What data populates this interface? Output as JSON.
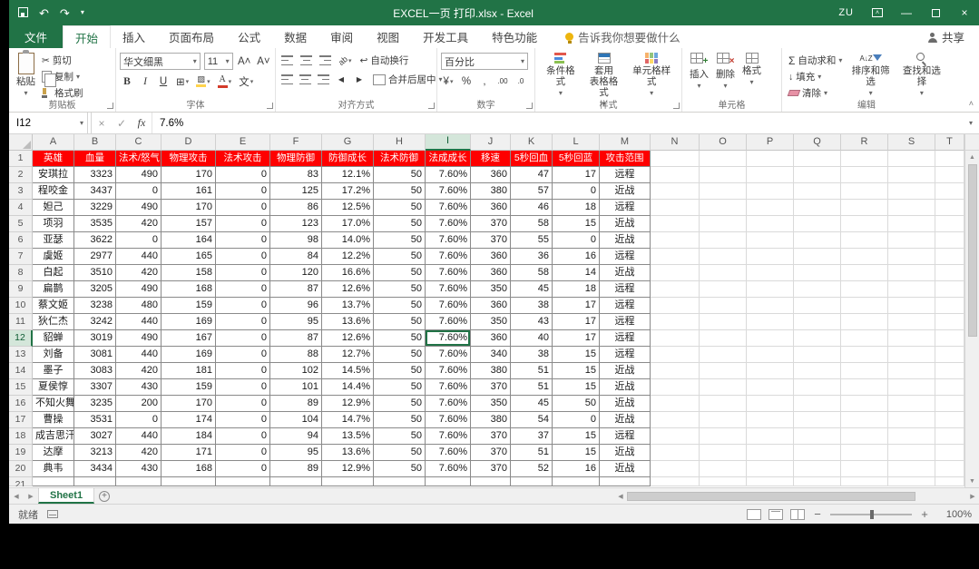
{
  "window": {
    "title": "EXCEL一页 打印.xlsx - Excel",
    "user": "ZU"
  },
  "tabs": {
    "file": "文件",
    "items": [
      "开始",
      "插入",
      "页面布局",
      "公式",
      "数据",
      "审阅",
      "视图",
      "开发工具",
      "特色功能"
    ],
    "selected_index": 0,
    "tell_me": "告诉我你想要做什么",
    "share": "共享"
  },
  "ribbon": {
    "font_name": "华文细黑",
    "font_size": "11",
    "number_format": "百分比",
    "clipboard": {
      "group": "剪贴板",
      "paste": "粘贴",
      "cut": "剪切",
      "copy": "复制",
      "painter": "格式刷"
    },
    "font_group": "字体",
    "alignment": {
      "group": "对齐方式",
      "wrap": "自动换行",
      "merge": "合并后居中"
    },
    "number_group": "数字",
    "styles": {
      "group": "样式",
      "conditional": "条件格式",
      "table_line1": "套用",
      "table_line2": "表格格式",
      "cell": "单元格样式"
    },
    "cells": {
      "group": "单元格",
      "insert": "插入",
      "delete": "删除",
      "format": "格式"
    },
    "editing": {
      "group": "编辑",
      "autosum": "自动求和",
      "fill": "填充",
      "clear": "清除",
      "sort": "排序和筛选",
      "find": "查找和选择"
    }
  },
  "formula_bar": {
    "name_box": "I12",
    "fx": "fx",
    "value": "7.6%"
  },
  "selection": {
    "cell_ref": "I12"
  },
  "grid": {
    "columns": [
      "A",
      "B",
      "C",
      "D",
      "E",
      "F",
      "G",
      "H",
      "I",
      "J",
      "K",
      "L",
      "M",
      "N",
      "O",
      "P",
      "Q",
      "R",
      "S",
      "T"
    ],
    "row_count": 21
  },
  "table": {
    "headers": [
      "英雄",
      "血量",
      "法术/怒气",
      "物理攻击",
      "法术攻击",
      "物理防御",
      "防御成长",
      "法术防御",
      "法成成长",
      "移速",
      "5秒回血",
      "5秒回蓝",
      "攻击范围"
    ],
    "rows": [
      [
        "安琪拉",
        "3323",
        "490",
        "170",
        "0",
        "83",
        "12.1%",
        "50",
        "7.60%",
        "360",
        "47",
        "17",
        "远程"
      ],
      [
        "程咬金",
        "3437",
        "0",
        "161",
        "0",
        "125",
        "17.2%",
        "50",
        "7.60%",
        "380",
        "57",
        "0",
        "近战"
      ],
      [
        "妲己",
        "3229",
        "490",
        "170",
        "0",
        "86",
        "12.5%",
        "50",
        "7.60%",
        "360",
        "46",
        "18",
        "远程"
      ],
      [
        "项羽",
        "3535",
        "420",
        "157",
        "0",
        "123",
        "17.0%",
        "50",
        "7.60%",
        "370",
        "58",
        "15",
        "近战"
      ],
      [
        "亚瑟",
        "3622",
        "0",
        "164",
        "0",
        "98",
        "14.0%",
        "50",
        "7.60%",
        "370",
        "55",
        "0",
        "近战"
      ],
      [
        "虞姬",
        "2977",
        "440",
        "165",
        "0",
        "84",
        "12.2%",
        "50",
        "7.60%",
        "360",
        "36",
        "16",
        "远程"
      ],
      [
        "白起",
        "3510",
        "420",
        "158",
        "0",
        "120",
        "16.6%",
        "50",
        "7.60%",
        "360",
        "58",
        "14",
        "近战"
      ],
      [
        "扁鹊",
        "3205",
        "490",
        "168",
        "0",
        "87",
        "12.6%",
        "50",
        "7.60%",
        "350",
        "45",
        "18",
        "远程"
      ],
      [
        "蔡文姬",
        "3238",
        "480",
        "159",
        "0",
        "96",
        "13.7%",
        "50",
        "7.60%",
        "360",
        "38",
        "17",
        "远程"
      ],
      [
        "狄仁杰",
        "3242",
        "440",
        "169",
        "0",
        "95",
        "13.6%",
        "50",
        "7.60%",
        "350",
        "43",
        "17",
        "远程"
      ],
      [
        "貂蝉",
        "3019",
        "490",
        "167",
        "0",
        "87",
        "12.6%",
        "50",
        "7.60%",
        "360",
        "40",
        "17",
        "远程"
      ],
      [
        "刘备",
        "3081",
        "440",
        "169",
        "0",
        "88",
        "12.7%",
        "50",
        "7.60%",
        "340",
        "38",
        "15",
        "远程"
      ],
      [
        "墨子",
        "3083",
        "420",
        "181",
        "0",
        "102",
        "14.5%",
        "50",
        "7.60%",
        "380",
        "51",
        "15",
        "近战"
      ],
      [
        "夏侯惇",
        "3307",
        "430",
        "159",
        "0",
        "101",
        "14.4%",
        "50",
        "7.60%",
        "370",
        "51",
        "15",
        "近战"
      ],
      [
        "不知火舞",
        "3235",
        "200",
        "170",
        "0",
        "89",
        "12.9%",
        "50",
        "7.60%",
        "350",
        "45",
        "50",
        "近战"
      ],
      [
        "曹操",
        "3531",
        "0",
        "174",
        "0",
        "104",
        "14.7%",
        "50",
        "7.60%",
        "380",
        "54",
        "0",
        "近战"
      ],
      [
        "成吉思汗",
        "3027",
        "440",
        "184",
        "0",
        "94",
        "13.5%",
        "50",
        "7.60%",
        "370",
        "37",
        "15",
        "远程"
      ],
      [
        "达摩",
        "3213",
        "420",
        "171",
        "0",
        "95",
        "13.6%",
        "50",
        "7.60%",
        "370",
        "51",
        "15",
        "近战"
      ],
      [
        "典韦",
        "3434",
        "430",
        "168",
        "0",
        "89",
        "12.9%",
        "50",
        "7.60%",
        "370",
        "52",
        "16",
        "近战"
      ]
    ]
  },
  "sheet_tab": "Sheet1",
  "status": {
    "ready": "就绪",
    "zoom": "100%"
  },
  "colors": {
    "accent_green": "#217346",
    "header_red": "#fe0000",
    "header_text": "#ffffff"
  },
  "icons": {
    "caret": "▾",
    "undo": "↶",
    "redo": "↷",
    "cut": "✂",
    "check": "✓",
    "close": "×",
    "minimize": "—",
    "sigma": "Σ",
    "percent": "%",
    "comma": ",",
    "currency": "¥",
    "bold": "B",
    "italic": "I",
    "underline": "U",
    "borders": "⊞",
    "phonetic": "文",
    "orientation": "ab",
    "wrap_arrow": "↩",
    "fill_arrow": "↓",
    "up": "▲",
    "down": "▼",
    "left": "◀",
    "right": "▶",
    "grow_font": "A˄",
    "shrink_font": "A˅",
    "dec0": ".0",
    "dec00": ".00",
    "az": "A↓Z",
    "collapse": "˄",
    "plus": "+"
  }
}
